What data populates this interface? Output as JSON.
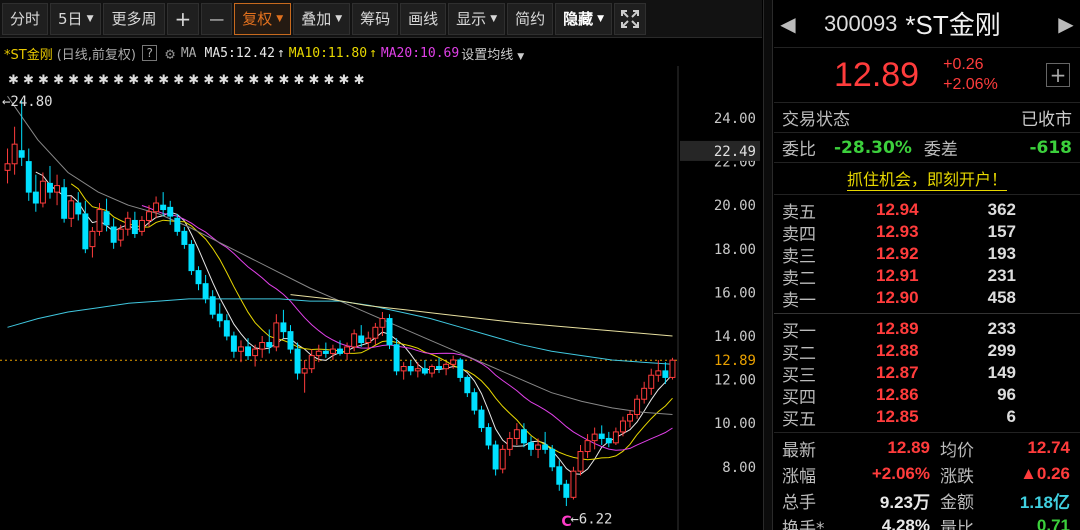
{
  "toolbar": {
    "items": [
      "分时",
      "5日",
      "更多周",
      "+",
      "—",
      "复权",
      "叠加",
      "筹码",
      "画线",
      "显示",
      "简约",
      "隐藏"
    ],
    "active_index": 5,
    "fullscreen_icon": "fullscreen-icon"
  },
  "legend": {
    "name": "*ST金刚",
    "sub": "(日线,前复权)",
    "help": "?",
    "ma": "MA",
    "ma5": "MA5:12.42",
    "ma10": "MA10:11.80",
    "ma20": "MA20:10.69",
    "arrow": "↑",
    "set_ma": "设置均线",
    "colors": {
      "ma5": "#e8e8e8",
      "ma10": "#e8d800",
      "ma20": "#e040e8",
      "ma60": "#888888",
      "ma120": "#40c8e0",
      "ma250": "#e8e0a0"
    }
  },
  "chart_data": {
    "type": "candlestick",
    "ylim": [
      6,
      26
    ],
    "y_ticks": [
      "24.00",
      "22.00",
      "20.00",
      "18.00",
      "16.00",
      "14.00",
      "12.00",
      "10.00",
      "8.00"
    ],
    "y_tick_values": [
      24,
      22,
      20,
      18,
      16,
      14,
      12,
      10,
      8
    ],
    "current_price_label": "12.89",
    "current_price": 12.89,
    "high_marker": "22.49",
    "high_value": 22.49,
    "max_annotation": "←24.80",
    "min_annotation": "←6.22",
    "min_value": 6.22,
    "c_marker": "C",
    "candles": [
      [
        21.6,
        22.6,
        21.0,
        21.9
      ],
      [
        21.9,
        23.6,
        21.4,
        22.8
      ],
      [
        22.5,
        24.8,
        21.8,
        22.2
      ],
      [
        22.0,
        22.6,
        20.2,
        20.6
      ],
      [
        20.6,
        21.4,
        19.7,
        20.1
      ],
      [
        20.1,
        21.5,
        19.9,
        21.1
      ],
      [
        21.0,
        21.8,
        20.3,
        20.6
      ],
      [
        20.6,
        21.4,
        20.0,
        20.9
      ],
      [
        20.8,
        21.2,
        19.2,
        19.4
      ],
      [
        19.4,
        20.4,
        19.0,
        20.2
      ],
      [
        20.1,
        20.6,
        19.3,
        19.6
      ],
      [
        19.6,
        20.2,
        17.8,
        18.0
      ],
      [
        18.1,
        19.0,
        17.6,
        18.8
      ],
      [
        18.8,
        20.1,
        18.6,
        19.8
      ],
      [
        19.7,
        20.3,
        18.8,
        19.1
      ],
      [
        19.0,
        19.4,
        18.0,
        18.3
      ],
      [
        18.4,
        19.1,
        18.1,
        18.9
      ],
      [
        18.9,
        19.7,
        18.6,
        19.4
      ],
      [
        19.3,
        19.7,
        18.5,
        18.7
      ],
      [
        18.8,
        19.5,
        18.6,
        19.3
      ],
      [
        19.3,
        20.0,
        19.0,
        19.7
      ],
      [
        19.7,
        20.4,
        19.4,
        20.1
      ],
      [
        20.0,
        20.6,
        19.5,
        19.8
      ],
      [
        19.9,
        20.2,
        19.1,
        19.5
      ],
      [
        19.4,
        19.6,
        18.6,
        18.8
      ],
      [
        18.8,
        19.0,
        18.0,
        18.2
      ],
      [
        18.2,
        18.4,
        16.8,
        17.0
      ],
      [
        17.0,
        17.2,
        16.1,
        16.4
      ],
      [
        16.4,
        16.8,
        15.5,
        15.7
      ],
      [
        15.8,
        16.1,
        14.8,
        15.0
      ],
      [
        15.0,
        15.5,
        14.4,
        14.7
      ],
      [
        14.7,
        15.0,
        13.8,
        14.0
      ],
      [
        14.0,
        14.2,
        13.0,
        13.3
      ],
      [
        13.3,
        13.8,
        12.8,
        13.5
      ],
      [
        13.5,
        13.9,
        12.9,
        13.1
      ],
      [
        13.1,
        13.6,
        12.6,
        13.4
      ],
      [
        13.4,
        14.0,
        13.0,
        13.7
      ],
      [
        13.7,
        14.3,
        13.2,
        13.5
      ],
      [
        13.5,
        15.0,
        13.3,
        14.6
      ],
      [
        14.6,
        15.2,
        13.9,
        14.2
      ],
      [
        14.2,
        14.5,
        13.2,
        13.4
      ],
      [
        13.4,
        13.7,
        12.0,
        12.3
      ],
      [
        12.3,
        12.9,
        11.4,
        12.5
      ],
      [
        12.5,
        13.4,
        12.3,
        13.1
      ],
      [
        13.1,
        13.6,
        12.8,
        13.3
      ],
      [
        13.3,
        13.7,
        13.0,
        13.2
      ],
      [
        13.2,
        13.6,
        12.9,
        13.4
      ],
      [
        13.4,
        13.8,
        13.1,
        13.2
      ],
      [
        13.2,
        13.7,
        12.9,
        13.5
      ],
      [
        13.5,
        14.3,
        13.3,
        14.1
      ],
      [
        14.0,
        14.5,
        13.5,
        13.7
      ],
      [
        13.7,
        14.2,
        13.4,
        13.9
      ],
      [
        13.9,
        14.6,
        13.6,
        14.4
      ],
      [
        14.4,
        15.1,
        14.0,
        14.8
      ],
      [
        14.8,
        15.0,
        13.4,
        13.6
      ],
      [
        13.6,
        13.9,
        12.2,
        12.4
      ],
      [
        12.4,
        12.8,
        12.0,
        12.6
      ],
      [
        12.6,
        12.9,
        12.2,
        12.4
      ],
      [
        12.4,
        12.8,
        12.1,
        12.5
      ],
      [
        12.5,
        12.9,
        12.2,
        12.3
      ],
      [
        12.3,
        12.7,
        12.1,
        12.6
      ],
      [
        12.6,
        13.0,
        12.3,
        12.5
      ],
      [
        12.5,
        12.8,
        12.2,
        12.7
      ],
      [
        12.7,
        13.1,
        12.5,
        12.9
      ],
      [
        12.9,
        13.0,
        11.9,
        12.1
      ],
      [
        12.1,
        12.2,
        11.2,
        11.4
      ],
      [
        11.4,
        11.6,
        10.4,
        10.6
      ],
      [
        10.6,
        10.8,
        9.6,
        9.8
      ],
      [
        9.8,
        10.0,
        8.8,
        9.0
      ],
      [
        9.0,
        9.2,
        7.6,
        7.9
      ],
      [
        7.9,
        9.0,
        7.7,
        8.8
      ],
      [
        8.8,
        9.6,
        8.5,
        9.3
      ],
      [
        9.3,
        10.0,
        9.0,
        9.7
      ],
      [
        9.7,
        10.0,
        8.9,
        9.1
      ],
      [
        9.1,
        9.4,
        8.5,
        8.8
      ],
      [
        8.8,
        9.3,
        8.4,
        9.0
      ],
      [
        9.0,
        9.6,
        8.6,
        8.8
      ],
      [
        8.8,
        9.0,
        7.8,
        8.0
      ],
      [
        8.0,
        8.3,
        6.9,
        7.2
      ],
      [
        7.2,
        7.4,
        6.2,
        6.6
      ],
      [
        6.6,
        8.0,
        6.5,
        7.8
      ],
      [
        7.8,
        9.0,
        7.6,
        8.7
      ],
      [
        8.7,
        9.5,
        8.4,
        9.2
      ],
      [
        9.2,
        9.8,
        8.8,
        9.5
      ],
      [
        9.5,
        9.9,
        9.0,
        9.3
      ],
      [
        9.3,
        9.6,
        8.9,
        9.1
      ],
      [
        9.1,
        9.8,
        9.0,
        9.6
      ],
      [
        9.6,
        10.3,
        9.4,
        10.1
      ],
      [
        10.1,
        10.6,
        9.8,
        10.4
      ],
      [
        10.4,
        11.3,
        10.2,
        11.1
      ],
      [
        11.1,
        11.9,
        10.9,
        11.6
      ],
      [
        11.6,
        12.5,
        11.3,
        12.2
      ],
      [
        12.2,
        12.9,
        11.9,
        12.4
      ],
      [
        12.4,
        12.8,
        11.8,
        12.1
      ],
      [
        12.1,
        13.0,
        12.0,
        12.89
      ]
    ],
    "ma_long_series": {
      "ma60": [
        25.0,
        23.0,
        21.5,
        20.6,
        20.0,
        19.6,
        19.0,
        18.3,
        17.6,
        16.9,
        16.2,
        15.6,
        15.0,
        14.4,
        13.8,
        13.2,
        12.6,
        12.0,
        11.4,
        11.0,
        10.7,
        10.5,
        10.4
      ],
      "ma120": [
        14.4,
        14.8,
        15.1,
        15.3,
        15.5,
        15.6,
        15.7,
        15.7,
        15.7,
        15.7,
        15.6,
        15.6,
        15.4,
        15.1,
        14.8,
        14.4,
        14.0,
        13.6,
        13.3,
        13.1,
        12.9,
        12.8,
        12.7
      ],
      "ma250": [
        15.9,
        15.7,
        15.4,
        15.2,
        15.0,
        14.8,
        14.6,
        14.45,
        14.3,
        14.15,
        14.0
      ],
      "ma250_start_index": 50
    }
  },
  "panel": {
    "code": "300093",
    "name": "*ST金刚",
    "price": "12.89",
    "change": "+0.26",
    "change_pct": "+2.06%",
    "trade_status_label": "交易状态",
    "trade_status": "已收市",
    "wb_label": "委比",
    "wb": "-28.30%",
    "wc_label": "委差",
    "wc": "-618",
    "promo": "抓住机会，即刻开户！",
    "asks": [
      {
        "label": "卖五",
        "price": "12.94",
        "vol": "362"
      },
      {
        "label": "卖四",
        "price": "12.93",
        "vol": "157"
      },
      {
        "label": "卖三",
        "price": "12.92",
        "vol": "193"
      },
      {
        "label": "卖二",
        "price": "12.91",
        "vol": "231"
      },
      {
        "label": "卖一",
        "price": "12.90",
        "vol": "458"
      }
    ],
    "bids": [
      {
        "label": "买一",
        "price": "12.89",
        "vol": "233"
      },
      {
        "label": "买二",
        "price": "12.88",
        "vol": "299"
      },
      {
        "label": "买三",
        "price": "12.87",
        "vol": "149"
      },
      {
        "label": "买四",
        "price": "12.86",
        "vol": "96"
      },
      {
        "label": "买五",
        "price": "12.85",
        "vol": "6"
      }
    ],
    "stats": [
      {
        "l": "最新",
        "v": "12.89",
        "vc": "red",
        "l2": "均价",
        "v2": "12.74",
        "v2c": "red"
      },
      {
        "l": "涨幅",
        "v": "+2.06%",
        "vc": "red",
        "l2": "涨跌",
        "v2": "▲0.26",
        "v2c": "red"
      },
      {
        "l": "总手",
        "v": "9.23万",
        "vc": "white",
        "l2": "金额",
        "v2": "1.18亿",
        "v2c": "cyan"
      },
      {
        "l": "换手*",
        "v": "4.28%",
        "vc": "white",
        "l2": "量比",
        "v2": "0.71",
        "v2c": "green"
      }
    ]
  }
}
